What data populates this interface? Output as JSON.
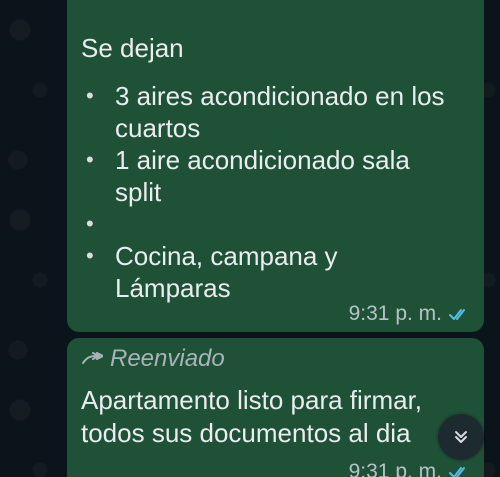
{
  "messages": [
    {
      "intro": "Se dejan",
      "bullets": [
        [
          "3 aires acondicionado en los",
          "cuartos"
        ],
        [
          "1 aire acondicionado sala",
          "split"
        ],
        [
          " Cocina, campana y",
          "Lámparas"
        ]
      ],
      "time": "9:31 p. m."
    },
    {
      "forwarded_label": "Reenviado",
      "text_lines": [
        "Apartamento listo para firmar,",
        "todos sus documentos al dia"
      ],
      "time": "9:31 p. m."
    }
  ],
  "icons": {
    "forward": "forward-icon",
    "read_receipt": "double-check-icon",
    "scroll_down": "double-chevron-down-icon"
  },
  "colors": {
    "background": "#0b141a",
    "bubble": "#1f5136",
    "text": "#eef2f3",
    "meta": "#b7c2c8",
    "read_receipt": "#53bdeb"
  }
}
